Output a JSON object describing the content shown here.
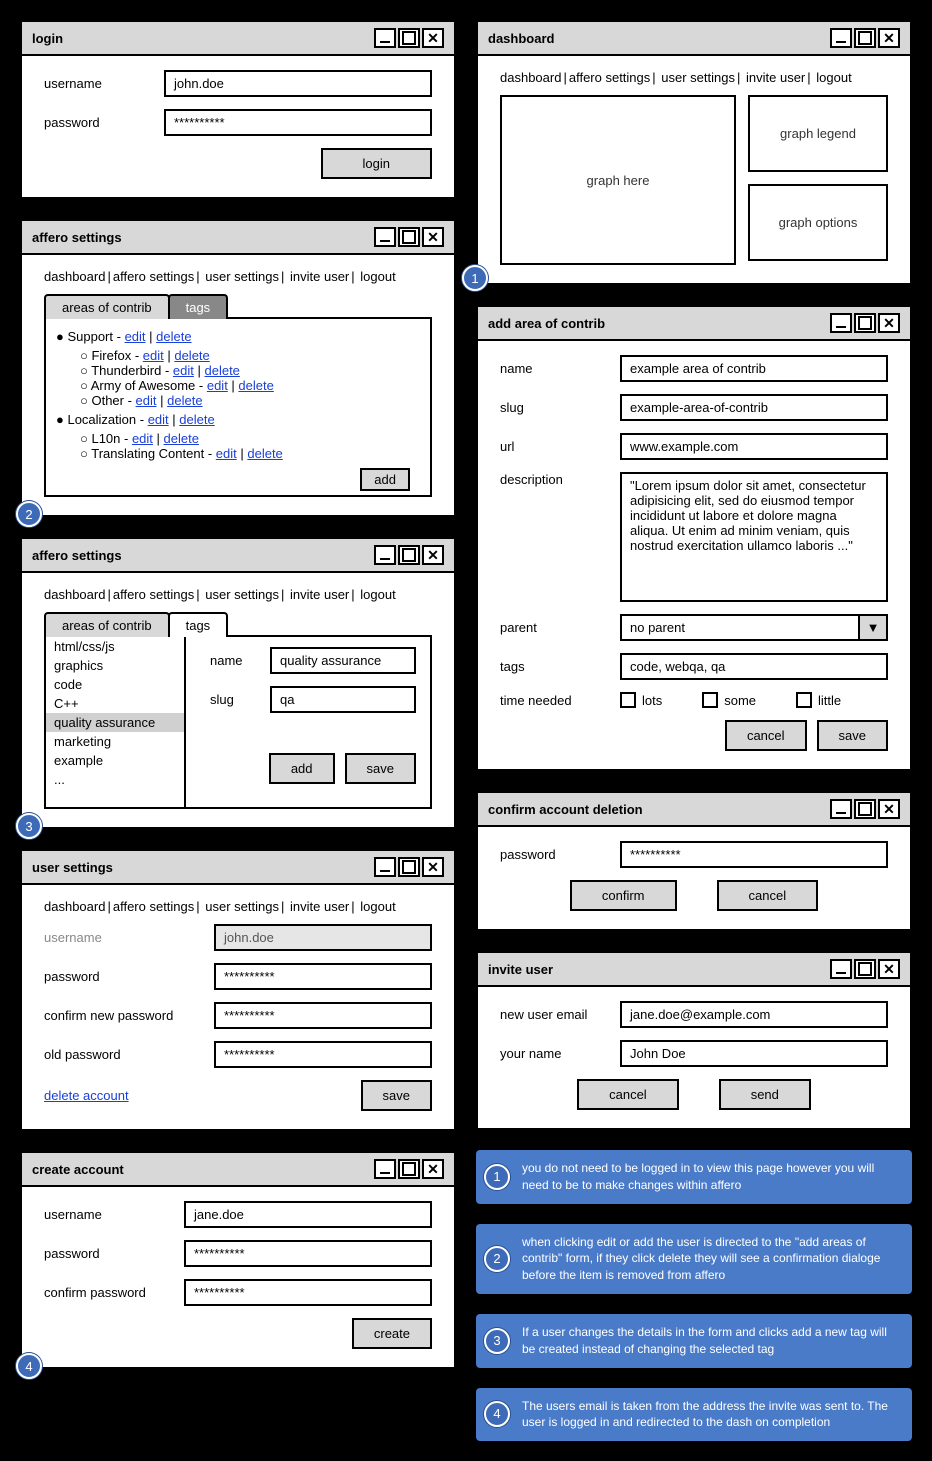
{
  "login": {
    "title": "login",
    "username_label": "username",
    "username_value": "john.doe",
    "password_label": "password",
    "password_value": "**********",
    "button": "login"
  },
  "nav": {
    "dashboard": "dashboard",
    "affero": "affero settings",
    "user": "user settings",
    "invite": "invite user",
    "logout": "logout"
  },
  "affero1": {
    "title": "affero settings",
    "tab_areas": "areas of contrib",
    "tab_tags": "tags",
    "add_button": "add",
    "tree": {
      "support": "Support",
      "firefox": "Firefox",
      "thunderbird": "Thunderbird",
      "army": "Army of Awesome",
      "other": "Other",
      "localization": "Localization",
      "l10n": "L10n",
      "translating": "Translating Content"
    },
    "link_edit": "edit",
    "link_delete": "delete"
  },
  "affero2": {
    "title": "affero settings",
    "tab_areas": "areas of contrib",
    "tab_tags": "tags",
    "name_label": "name",
    "name_value": "quality assurance",
    "slug_label": "slug",
    "slug_value": "qa",
    "add_button": "add",
    "save_button": "save",
    "list": {
      "i0": "html/css/js",
      "i1": "graphics",
      "i2": "code",
      "i3": "C++",
      "i4": "quality assurance",
      "i5": "marketing",
      "i6": "example",
      "i7": "..."
    }
  },
  "user_settings": {
    "title": "user settings",
    "username_label": "username",
    "username_value": "john.doe",
    "password_label": "password",
    "confirm_label": "confirm new password",
    "old_label": "old password",
    "masked": "**********",
    "delete_link": "delete account",
    "save_button": "save"
  },
  "create": {
    "title": "create account",
    "username_label": "username",
    "username_value": "jane.doe",
    "password_label": "password",
    "confirm_label": "confirm password",
    "masked": "**********",
    "button": "create"
  },
  "dashboard": {
    "title": "dashboard",
    "graph": "graph here",
    "legend": "graph legend",
    "options": "graph options"
  },
  "add_area": {
    "title": "add area of contrib",
    "name_label": "name",
    "name_value": "example area of contrib",
    "slug_label": "slug",
    "slug_value": "example-area-of-contrib",
    "url_label": "url",
    "url_value": "www.example.com",
    "desc_label": "description",
    "desc_value": "\"Lorem ipsum dolor sit amet, consectetur adipisicing elit, sed do eiusmod tempor incididunt ut labore et dolore magna aliqua. Ut enim ad minim veniam, quis nostrud exercitation ullamco laboris ...\"",
    "parent_label": "parent",
    "parent_value": "no parent",
    "tags_label": "tags",
    "tags_value": "code, webqa, qa",
    "time_label": "time needed",
    "time_lots": "lots",
    "time_some": "some",
    "time_little": "little",
    "cancel": "cancel",
    "save": "save"
  },
  "confirm_del": {
    "title": "confirm account deletion",
    "password_label": "password",
    "password_value": "**********",
    "confirm": "confirm",
    "cancel": "cancel"
  },
  "invite": {
    "title": "invite user",
    "email_label": "new user email",
    "email_value": "jane.doe@example.com",
    "name_label": "your name",
    "name_value": "John Doe",
    "cancel": "cancel",
    "send": "send"
  },
  "notes": {
    "n1": "you do not need to be logged in to view this page however you will need to be to make changes within affero",
    "n2": "when clicking edit or add the user is directed to the \"add areas of contrib\" form, if they click delete they will see a confirmation dialoge before the item is removed from affero",
    "n3": "If a user changes the details in the form and clicks add a new tag will be created instead of changing the selected tag",
    "n4": "The users email is taken from the address the invite was sent to. The user is logged in and redirected to the dash on completion"
  },
  "badges": {
    "b1": "1",
    "b2": "2",
    "b3": "3",
    "b4": "4"
  }
}
